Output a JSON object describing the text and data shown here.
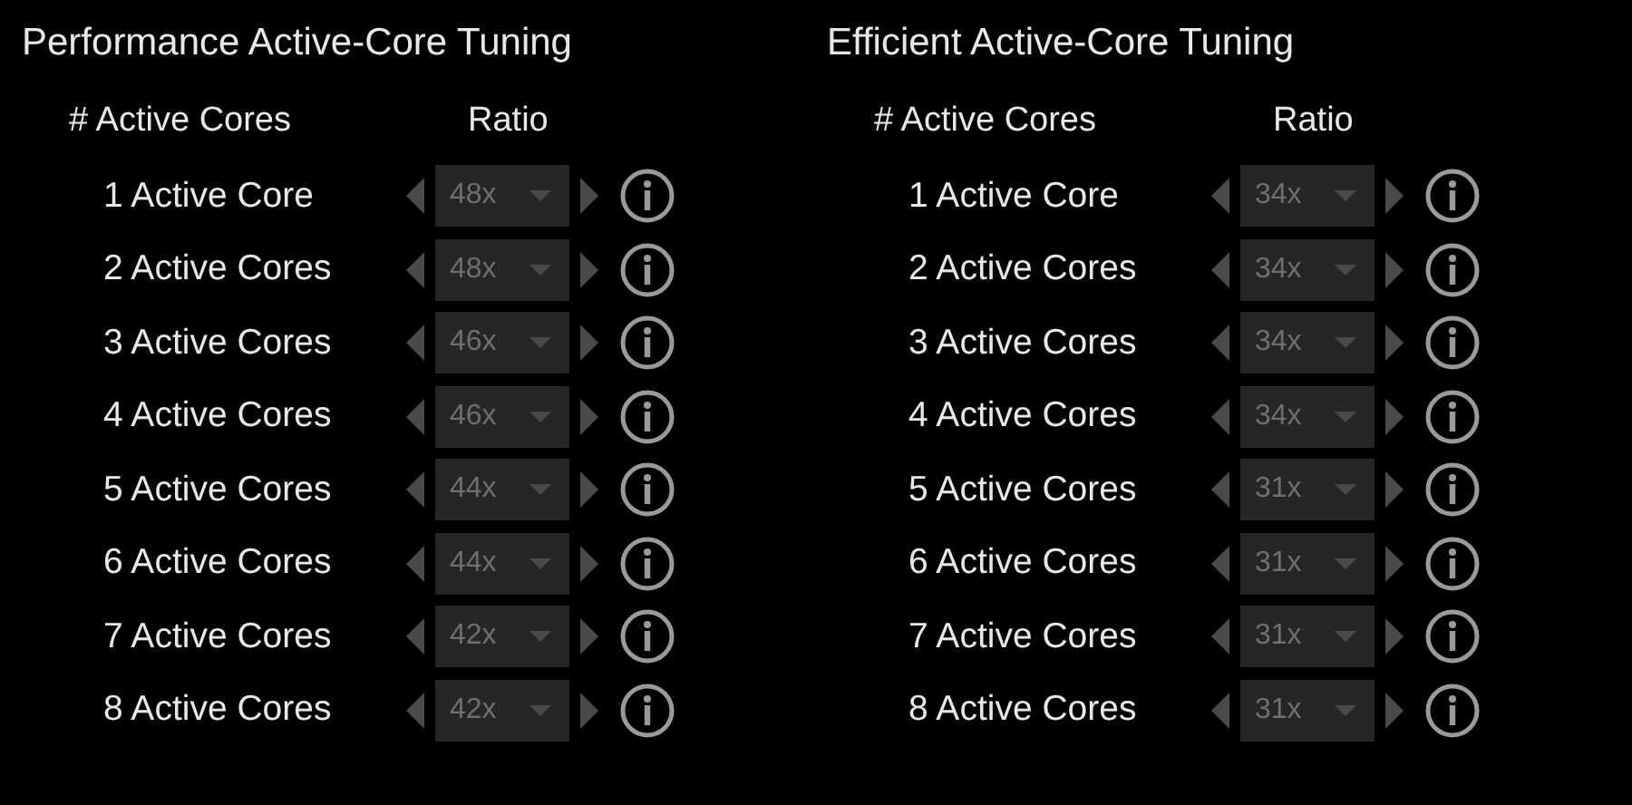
{
  "panels": [
    {
      "title": "Performance Active-Core Tuning",
      "column_headers": [
        "# Active Cores",
        "Ratio"
      ],
      "rows": [
        {
          "label": "1 Active Core",
          "ratio": "48x",
          "disabled": true
        },
        {
          "label": "2 Active Cores",
          "ratio": "48x",
          "disabled": true
        },
        {
          "label": "3 Active Cores",
          "ratio": "46x",
          "disabled": true
        },
        {
          "label": "4 Active Cores",
          "ratio": "46x",
          "disabled": true
        },
        {
          "label": "5 Active Cores",
          "ratio": "44x",
          "disabled": true
        },
        {
          "label": "6 Active Cores",
          "ratio": "44x",
          "disabled": true
        },
        {
          "label": "7 Active Cores",
          "ratio": "42x",
          "disabled": true
        },
        {
          "label": "8 Active Cores",
          "ratio": "42x",
          "disabled": true
        }
      ]
    },
    {
      "title": "Efficient Active-Core Tuning",
      "column_headers": [
        "# Active Cores",
        "Ratio"
      ],
      "rows": [
        {
          "label": "1 Active Core",
          "ratio": "34x",
          "disabled": true
        },
        {
          "label": "2 Active Cores",
          "ratio": "34x",
          "disabled": true
        },
        {
          "label": "3 Active Cores",
          "ratio": "34x",
          "disabled": true
        },
        {
          "label": "4 Active Cores",
          "ratio": "34x",
          "disabled": true
        },
        {
          "label": "5 Active Cores",
          "ratio": "31x",
          "disabled": true
        },
        {
          "label": "6 Active Cores",
          "ratio": "31x",
          "disabled": true
        },
        {
          "label": "7 Active Cores",
          "ratio": "31x",
          "disabled": true
        },
        {
          "label": "8 Active Cores",
          "ratio": "31x",
          "disabled": true
        }
      ]
    }
  ]
}
